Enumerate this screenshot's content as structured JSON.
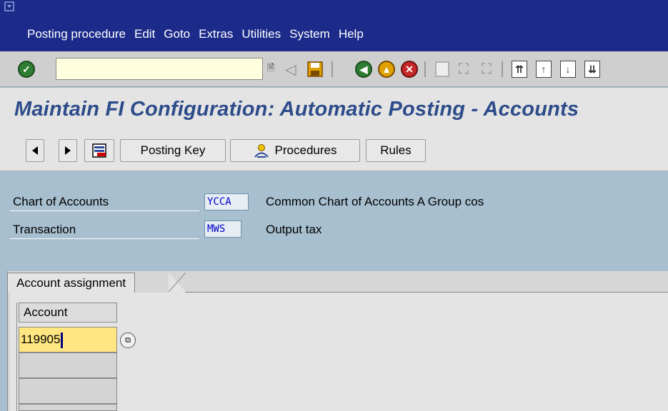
{
  "menubar": {
    "items": [
      "Posting procedure",
      "Edit",
      "Goto",
      "Extras",
      "Utilities",
      "System",
      "Help"
    ]
  },
  "toolbar": {
    "command_field_value": "",
    "icons": [
      "enter-icon",
      "back-arrow-icon",
      "save-icon",
      "back-icon",
      "exit-icon",
      "cancel-icon",
      "print-icon",
      "find-icon",
      "find-next-icon",
      "first-page-icon",
      "prev-page-icon",
      "next-page-icon",
      "last-page-icon"
    ]
  },
  "page": {
    "title": "Maintain FI Configuration: Automatic Posting - Accounts"
  },
  "app_toolbar": {
    "posting_key_label": "Posting Key",
    "procedures_label": "Procedures",
    "rules_label": "Rules"
  },
  "header": {
    "chart_of_accounts": {
      "label": "Chart of Accounts",
      "value": "YCCA",
      "description": "Common Chart of Accounts A Group cos"
    },
    "transaction": {
      "label": "Transaction",
      "value": "MWS",
      "description": "Output tax"
    }
  },
  "tab": {
    "label": "Account assignment"
  },
  "table": {
    "column_header": "Account",
    "rows": [
      "119905",
      "",
      "",
      ""
    ]
  },
  "colors": {
    "menubar_bg": "#1c2a8a",
    "title_text": "#2d4c8a",
    "header_bg": "#a7bfcf",
    "active_cell": "#ffe680"
  }
}
